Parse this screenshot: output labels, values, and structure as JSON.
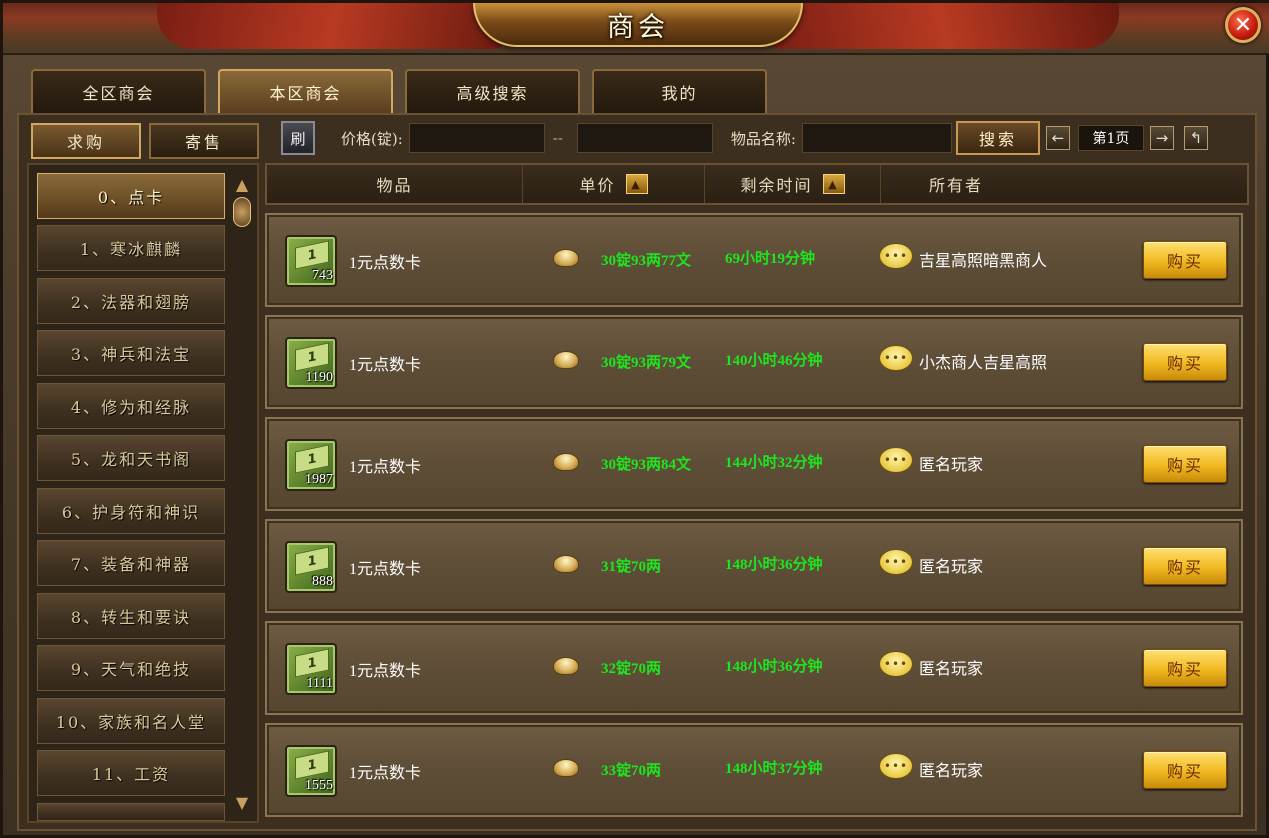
{
  "window": {
    "title": "商会",
    "close_symbol": "✕"
  },
  "main_tabs": [
    {
      "label": "全区商会",
      "active": false
    },
    {
      "label": "本区商会",
      "active": true
    },
    {
      "label": "高级搜索",
      "active": false
    },
    {
      "label": "我的",
      "active": false
    }
  ],
  "sub_tabs": [
    {
      "label": "求购",
      "active": true
    },
    {
      "label": "寄售",
      "active": false
    }
  ],
  "search": {
    "refresh_label": "刷",
    "price_label": "价格(锭):",
    "range_separator": "--",
    "price_min": "",
    "price_max": "",
    "item_name_label": "物品名称:",
    "item_name": "",
    "search_label": "搜索",
    "page_label": "第1页",
    "prev_symbol": "←",
    "next_symbol": "→",
    "back_symbol": "↰"
  },
  "categories": [
    {
      "label": "0、点卡",
      "active": true
    },
    {
      "label": "1、寒冰麒麟"
    },
    {
      "label": "2、法器和翅膀"
    },
    {
      "label": "3、神兵和法宝"
    },
    {
      "label": "4、修为和经脉"
    },
    {
      "label": "5、龙和天书阁"
    },
    {
      "label": "6、护身符和神识"
    },
    {
      "label": "7、装备和神器"
    },
    {
      "label": "8、转生和要诀"
    },
    {
      "label": "9、天气和绝技"
    },
    {
      "label": "10、家族和名人堂"
    },
    {
      "label": "11、工资"
    }
  ],
  "table": {
    "headers": {
      "item": "物品",
      "price": "单价",
      "time": "剩余时间",
      "owner": "所有者"
    },
    "sort_symbol": "▲",
    "buy_label": "购买",
    "rows": [
      {
        "item_name": "1元点数卡",
        "quantity": "743",
        "price": "30锭93两77文",
        "time_left": "69小时19分钟",
        "owner": "吉星高照暗黑商人"
      },
      {
        "item_name": "1元点数卡",
        "quantity": "1190",
        "price": "30锭93两79文",
        "time_left": "140小时46分钟",
        "owner": "小杰商人吉星高照"
      },
      {
        "item_name": "1元点数卡",
        "quantity": "1987",
        "price": "30锭93两84文",
        "time_left": "144小时32分钟",
        "owner": "匿名玩家"
      },
      {
        "item_name": "1元点数卡",
        "quantity": "888",
        "price": "31锭70两",
        "time_left": "148小时36分钟",
        "owner": "匿名玩家"
      },
      {
        "item_name": "1元点数卡",
        "quantity": "1111",
        "price": "32锭70两",
        "time_left": "148小时36分钟",
        "owner": "匿名玩家"
      },
      {
        "item_name": "1元点数卡",
        "quantity": "1555",
        "price": "33锭70两",
        "time_left": "148小时37分钟",
        "owner": "匿名玩家"
      }
    ]
  },
  "colors": {
    "price_green": "#1ee61e",
    "buy_gold": "#f0b820",
    "frame_brown": "#4a3b2a"
  }
}
